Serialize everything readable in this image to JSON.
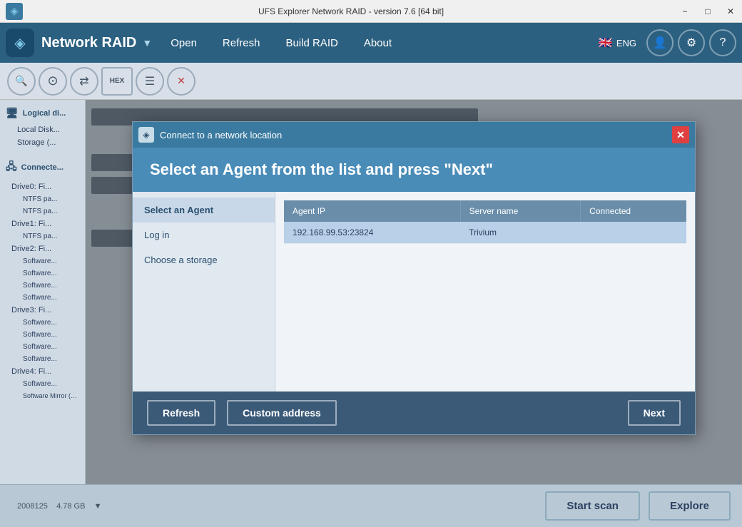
{
  "window": {
    "title": "UFS Explorer Network RAID - version 7.6 [64 bit]",
    "min_btn": "−",
    "max_btn": "□",
    "close_btn": "✕"
  },
  "menubar": {
    "logo_text": "Network RAID",
    "open_label": "Open",
    "refresh_label": "Refresh",
    "build_raid_label": "Build RAID",
    "about_label": "About",
    "lang": "ENG"
  },
  "toolbar": {
    "search_icon": "🔍",
    "drive_icon": "⊙",
    "layers_icon": "≡",
    "hex_icon": "HEX",
    "list_icon": "☰",
    "close_icon": "✕"
  },
  "sidebar": {
    "logical_di_label": "Logical di...",
    "local_disk_label": "Local Disk...",
    "storage_label": "Storage (...",
    "connected_label": "Connecte...",
    "drives": [
      {
        "label": "Drive0: Fi...",
        "partitions": [
          "NTFS pa...",
          "NTFS pa..."
        ]
      },
      {
        "label": "Drive1: Fi...",
        "partitions": [
          "NTFS pa..."
        ]
      },
      {
        "label": "Drive2: Fi...",
        "partitions": [
          "Software...",
          "Software...",
          "Software...",
          "Software..."
        ]
      },
      {
        "label": "Drive3: Fi...",
        "partitions": [
          "Software...",
          "Software...",
          "Software...",
          "Software..."
        ]
      },
      {
        "label": "Drive4: Fi...",
        "partitions": [
          "Software..."
        ]
      }
    ]
  },
  "right_panel": {
    "label1": "",
    "label2": ""
  },
  "bottom": {
    "start_scan_label": "Start scan",
    "explore_label": "Explore"
  },
  "modal": {
    "titlebar_title": "Connect to a network location",
    "header_text": "Select an Agent from the list and press \"Next\"",
    "sidebar_items": [
      {
        "label": "Select an Agent",
        "active": true
      },
      {
        "label": "Log in",
        "active": false
      },
      {
        "label": "Choose a storage",
        "active": false
      }
    ],
    "table": {
      "columns": [
        "Agent IP",
        "Server name",
        "Connected"
      ],
      "rows": [
        {
          "ip": "192.168.99.53:23824",
          "server": "Trivium",
          "connected": ""
        }
      ]
    },
    "footer": {
      "refresh_label": "Refresh",
      "custom_address_label": "Custom address",
      "next_label": "Next"
    }
  }
}
